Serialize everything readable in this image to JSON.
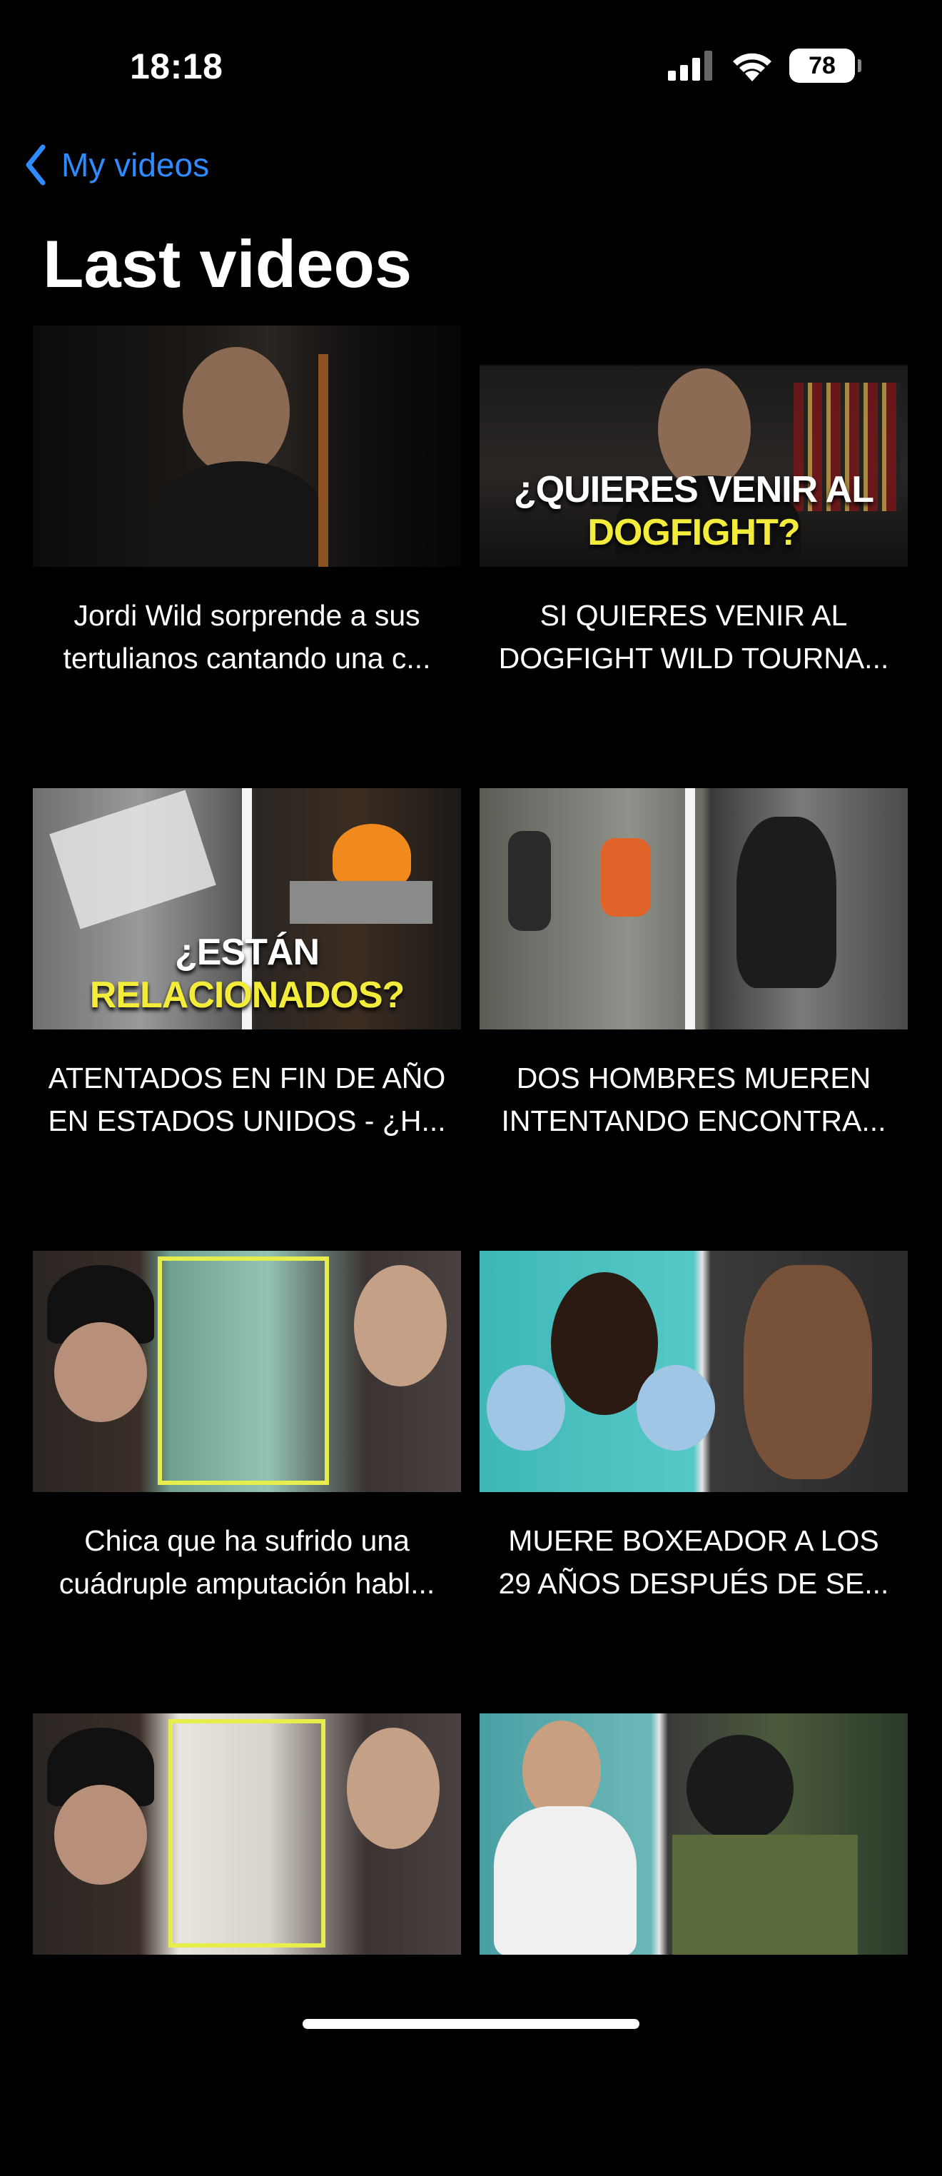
{
  "status_bar": {
    "time": "18:18",
    "battery": "78"
  },
  "nav": {
    "back_label": "My videos"
  },
  "title": "Last videos",
  "videos": [
    {
      "line1": "Jordi Wild sorprende a sus",
      "line2": "tertulianos cantando una c..."
    },
    {
      "line1": "SI QUIERES VENIR AL",
      "line2": "DOGFIGHT WILD TOURNA...",
      "overlay_a": "¿QUIERES VENIR AL ",
      "overlay_b": "DOGFIGHT?"
    },
    {
      "line1": "ATENTADOS EN FIN DE AÑO",
      "line2": "EN ESTADOS UNIDOS - ¿H...",
      "overlay_a": "¿ESTÁN ",
      "overlay_b": "RELACIONADOS?"
    },
    {
      "line1": "DOS HOMBRES MUEREN",
      "line2": "INTENTANDO ENCONTRA..."
    },
    {
      "line1": "Chica que ha sufrido una",
      "line2": "cuádruple amputación habl..."
    },
    {
      "line1": "MUERE BOXEADOR A LOS",
      "line2": "29 AÑOS DESPUÉS DE SE..."
    },
    {
      "line1": "",
      "line2": ""
    },
    {
      "line1": "",
      "line2": ""
    }
  ]
}
